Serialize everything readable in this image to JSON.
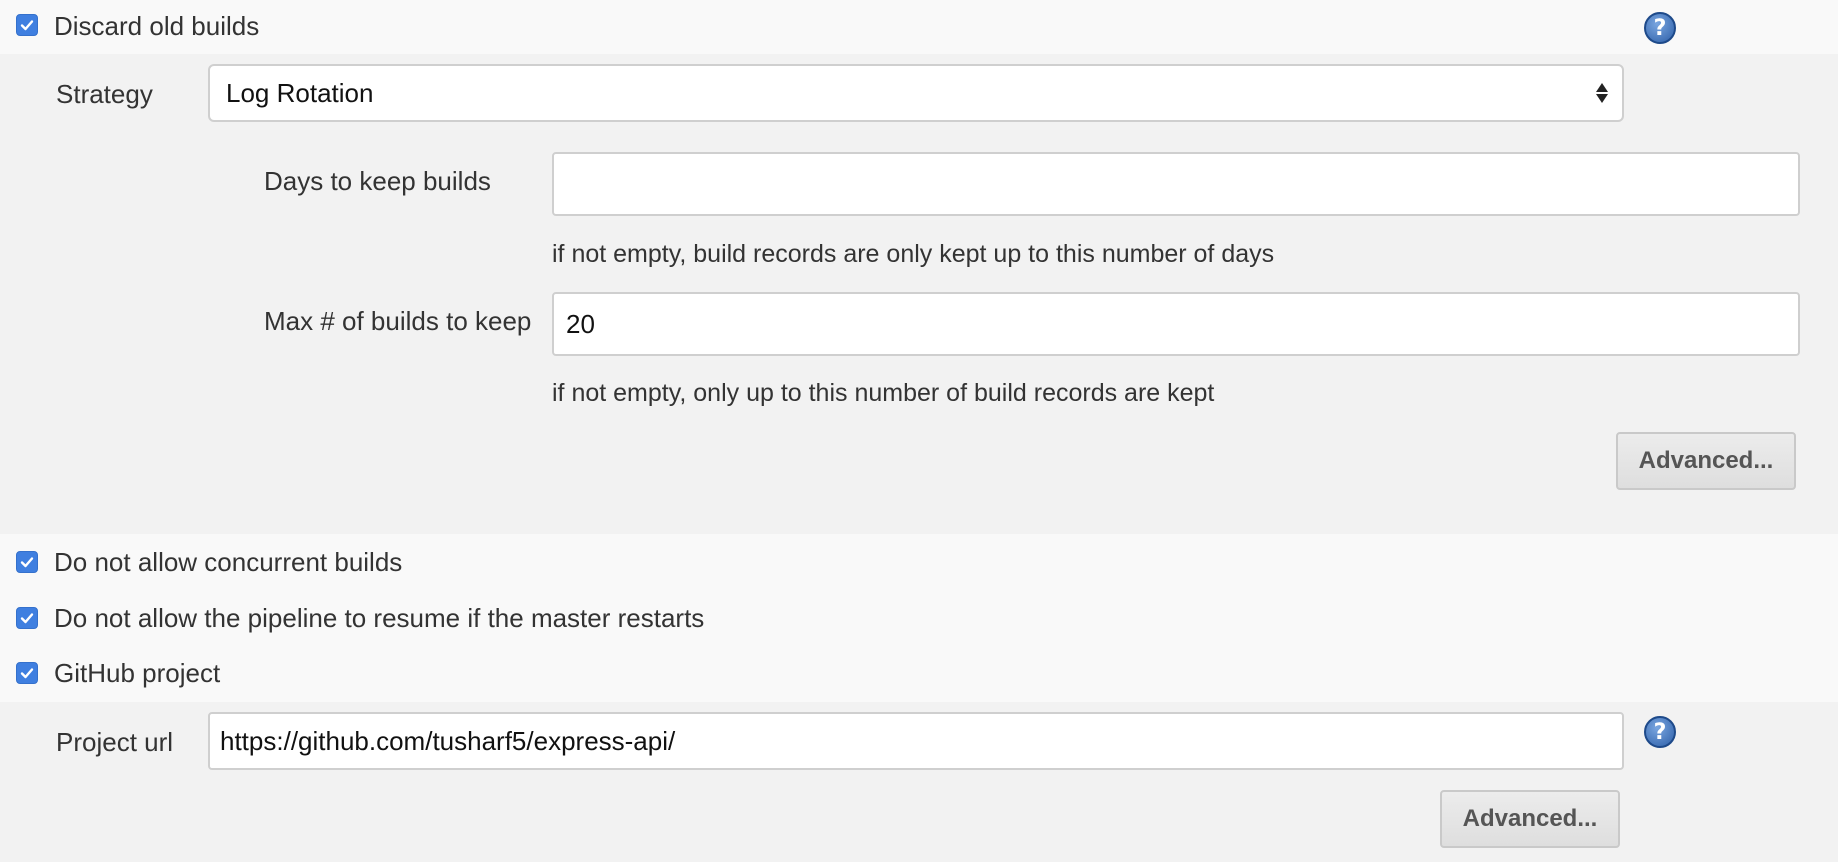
{
  "discard_old_builds": {
    "label": "Discard old builds",
    "checked": true,
    "help_icon": "?",
    "strategy": {
      "label": "Strategy",
      "selected": "Log Rotation"
    },
    "days_to_keep": {
      "label": "Days to keep builds",
      "value": "",
      "hint": "if not empty, build records are only kept up to this number of days"
    },
    "max_builds": {
      "label": "Max # of builds to keep",
      "value": "20",
      "hint": "if not empty, only up to this number of build records are kept"
    },
    "advanced_label": "Advanced..."
  },
  "options": [
    {
      "label": "Do not allow concurrent builds",
      "checked": true
    },
    {
      "label": "Do not allow the pipeline to resume if the master restarts",
      "checked": true
    },
    {
      "label": "GitHub project",
      "checked": true
    }
  ],
  "github_project": {
    "url_label": "Project url",
    "url_value": "https://github.com/tusharf5/express-api/",
    "help_icon": "?",
    "advanced_label": "Advanced..."
  },
  "colors": {
    "checkbox": "#3f7fe0",
    "panel_background": "#f2f2f2",
    "page_background": "#f9f9f9"
  }
}
